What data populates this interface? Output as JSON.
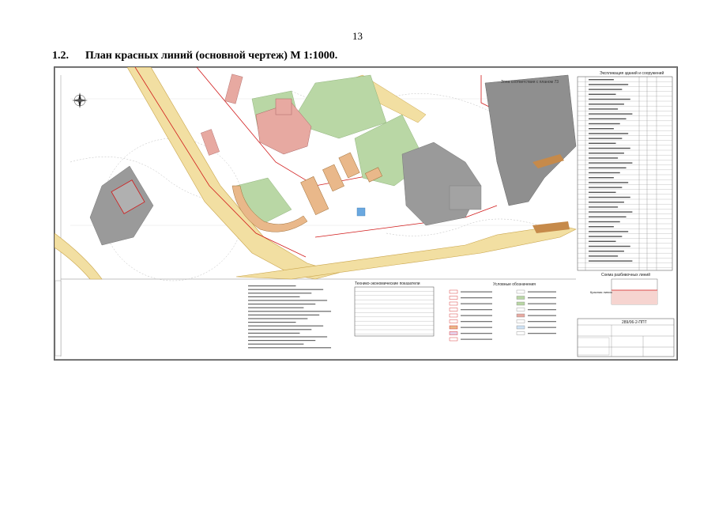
{
  "page_number": "13",
  "heading": {
    "number": "1.2.",
    "title": "План красных линий (основной чертеж) М 1:1000."
  },
  "drawing": {
    "table_title": "Экспликация зданий и сооружений",
    "legend_title": "Условные обозначения",
    "indicators_title": "Технико-экономические показатели",
    "scheme_title": "Схема разбивочных линий",
    "scheme_label": "Красная линия",
    "stamp_code": "289/06-2-ППТ",
    "map_note": "Зона соответствия с планом 73",
    "colors": {
      "road": "#f2dfa2",
      "road_edge": "#c9a44a",
      "built_gray": "#9a9a9a",
      "green_area": "#b9d7a5",
      "building_pink": "#e7a9a1",
      "building_orange": "#e9b88a",
      "red_line": "#d11a1a",
      "water_blue": "#6aa8e0"
    },
    "icons": [
      "north-arrow-icon"
    ]
  }
}
